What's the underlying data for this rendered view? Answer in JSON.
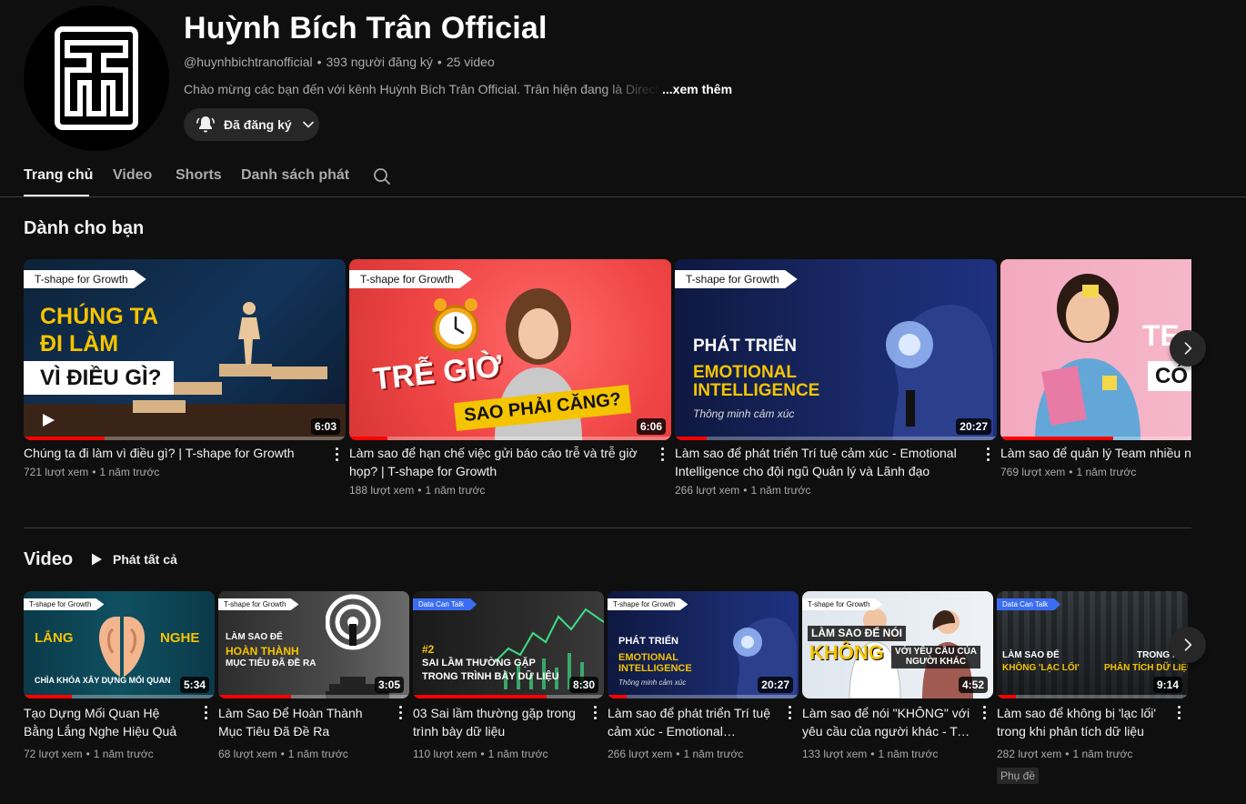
{
  "channel": {
    "name": "Huỳnh Bích Trân Official",
    "handle": "@huynhbichtranofficial",
    "subscribers": "393 người đăng ký",
    "video_count": "25 video",
    "description": "Chào mừng các bạn đến với kênh Huỳnh Bích Trân Official. Trân hiện đang là Director",
    "more_label": "...xem thêm",
    "subscribe_label": "Đã đăng ký"
  },
  "tabs": [
    "Trang chủ",
    "Video",
    "Shorts",
    "Danh sách phát"
  ],
  "for_you": {
    "title": "Dành cho bạn",
    "videos": [
      {
        "title": "Chúng ta đi làm vì điều gì? | T-shape for Growth",
        "views": "721 lượt xem",
        "age": "1 năm trước",
        "duration": "6:03",
        "series": "T-shape for Growth",
        "headline": [
          "CHÚNG TA",
          "ĐI LÀM",
          "VÌ ĐIỀU GÌ?"
        ],
        "progress": 0.25
      },
      {
        "title": "Làm sao để hạn chế việc gửi báo cáo trễ và trễ giờ họp? | T-shape for Growth",
        "views": "188 lượt xem",
        "age": "1 năm trước",
        "duration": "6:06",
        "series": "T-shape for Growth",
        "headline": [
          "TRỄ GIỜ",
          "SAO PHẢI CĂNG?"
        ],
        "progress": 0.12
      },
      {
        "title": "Làm sao để phát triển Trí tuệ cảm xúc - Emotional Intelligence cho đội ngũ Quản lý và Lãnh đạo",
        "views": "266 lượt xem",
        "age": "1 năm trước",
        "duration": "20:27",
        "series": "T-shape for Growth",
        "headline": [
          "PHÁT TRIỂN",
          "EMOTIONAL",
          "INTELLIGENCE",
          "Thông minh cảm xúc"
        ],
        "progress": 0.1
      },
      {
        "title": "Làm sao để quản lý Team nhiều người Growth",
        "views": "769 lượt xem",
        "age": "1 năm trước",
        "duration": "",
        "series": "",
        "headline": [
          "TE",
          "CÓ"
        ],
        "progress": 0.35
      }
    ]
  },
  "videos_shelf": {
    "title": "Video",
    "play_all": "Phát tất cả",
    "videos": [
      {
        "title": "Tạo Dựng Mối Quan Hệ Bằng Lắng Nghe Hiệu Quả",
        "views": "72 lượt xem",
        "age": "1 năm trước",
        "duration": "5:34",
        "series": "T-shape for Growth",
        "headline": [
          "LẮNG",
          "NGHE",
          "CHÌA KHÓA XÂY DỰNG MỐI QUAN"
        ],
        "progress": 0.25
      },
      {
        "title": "Làm Sao Để Hoàn Thành Mục Tiêu Đã Đề Ra",
        "views": "68 lượt xem",
        "age": "1 năm trước",
        "duration": "3:05",
        "series": "T-shape for Growth",
        "headline": [
          "LÀM SAO ĐỂ",
          "HOÀN THÀNH",
          "MỤC TIÊU ĐÃ ĐỀ RA"
        ],
        "progress": 0.38
      },
      {
        "title": "03 Sai lầm thường gặp trong trình bày dữ liệu",
        "views": "110 lượt xem",
        "age": "1 năm trước",
        "duration": "8:30",
        "series": "Data Can Talk",
        "headline": [
          "#2",
          "SAI LẦM THƯỜNG GẶP",
          "TRONG TRÌNH BÀY DỮ LIỆU"
        ],
        "progress": 0.7
      },
      {
        "title": "Làm sao để phát triển Trí tuệ cảm xúc - Emotional Intelligence cho đội ngũ Quản lý và Lãnh đạo",
        "views": "266 lượt xem",
        "age": "1 năm trước",
        "duration": "20:27",
        "series": "T-shape for Growth",
        "headline": [
          "PHÁT TRIỂN",
          "EMOTIONAL",
          "INTELLIGENCE",
          "Thông minh cảm xúc"
        ],
        "progress": 0.1
      },
      {
        "title": "Làm sao để nói \"KHÔNG\" với yêu cầu của người khác - T-shape for Growth",
        "views": "133 lượt xem",
        "age": "1 năm trước",
        "duration": "4:52",
        "series": "T-shape for Growth",
        "headline": [
          "LÀM SAO ĐỂ NÓI",
          "KHÔNG",
          "VỚI YÊU CẦU CỦA",
          "NGƯỜI KHÁC"
        ],
        "progress": 0.0
      },
      {
        "title": "Làm sao để không bị 'lạc lối' trong khi phân tích dữ liệu",
        "views": "282 lượt xem",
        "age": "1 năm trước",
        "duration": "9:14",
        "series": "Data Can Talk",
        "headline": [
          "LÀM SAO ĐỂ",
          "KHÔNG 'LẠC LỐI'",
          "TRONG KHI",
          "PHÂN TÍCH DỮ LIỆU"
        ],
        "progress": 0.1,
        "badge": "Phụ đề"
      }
    ]
  },
  "colors": {
    "accent_red": "#ff0000",
    "page_bg": "#0f0f0f",
    "chip_bg": "#272727",
    "muted_text": "#aaaaaa",
    "highlight_yellow": "#f5c400"
  },
  "icons": {
    "subscribe_bell": "bell-ringing-icon",
    "chevron": "chevron-down-icon",
    "search": "search-icon",
    "play": "play-icon",
    "next": "chevron-right-icon",
    "menu": "kebab-menu-icon"
  }
}
